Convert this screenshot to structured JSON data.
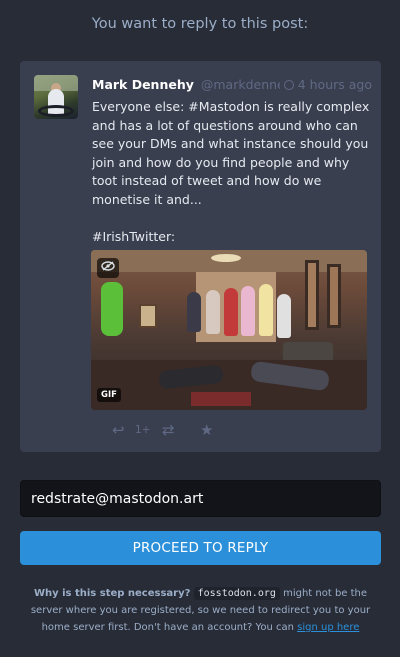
{
  "heading": "You want to reply to this post:",
  "status": {
    "display_name": "Mark Dennehy",
    "handle": "@markdennehy...",
    "time": "4 hours ago",
    "visibility_icon": "globe-icon",
    "paragraphs": [
      "Everyone else: #Mastodon is really complex and has a lot of questions around who can see your DMs and what instance should you join and how do you find people and why toot instead of tweet and how do we monetise it and...",
      "#IrishTwitter:"
    ],
    "media": {
      "type": "GIF",
      "badge": "GIF",
      "hide_icon": "eye-slash-icon"
    },
    "actions": {
      "reply_icon": "reply-icon",
      "reply_count": "1+",
      "boost_icon": "retweet-icon",
      "favourite_icon": "star-icon"
    }
  },
  "account_input": {
    "value": "redstrate@mastodon.art"
  },
  "proceed_label": "PROCEED TO REPLY",
  "hint": {
    "question": "Why is this step necessary?",
    "server": "fosstodon.org",
    "text_before": "might not be the server where you are registered, so we need to redirect you to your home server first. Don't have an account? You can",
    "signup_link": "sign up here"
  },
  "colors": {
    "background": "#282c37",
    "card": "#393f4f",
    "accent": "#2b90d9",
    "muted": "#606984"
  }
}
